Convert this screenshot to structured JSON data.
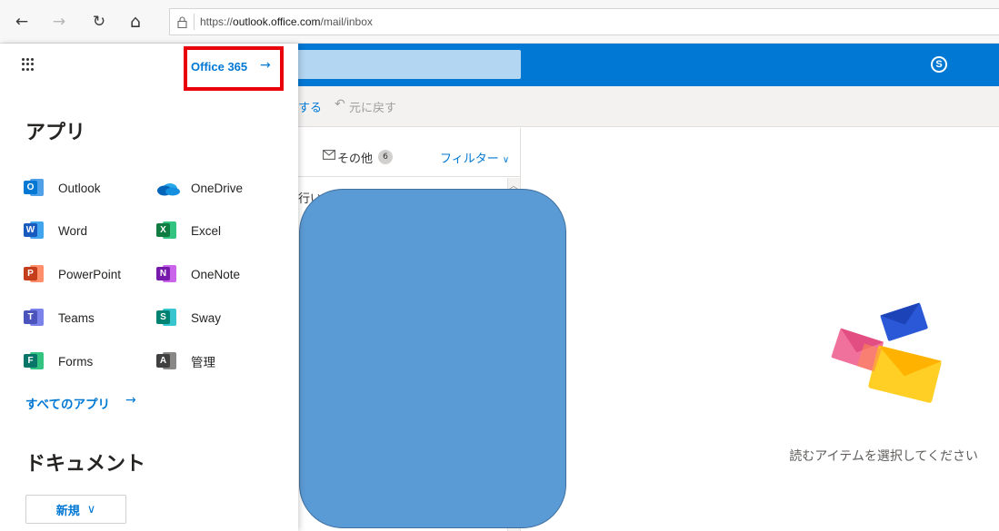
{
  "browser": {
    "back_icon": "←",
    "forward_icon": "→",
    "refresh_icon": "↻",
    "home_icon": "⌂",
    "url_prefix": "https://",
    "url_host": "outlook.office.com",
    "url_path": "/mail/inbox"
  },
  "header": {
    "skype_letter": "S"
  },
  "command_bar": {
    "action_label": "する",
    "undo_icon": "↶",
    "undo_label": "元に戻す"
  },
  "message_list": {
    "tab_other_label": "その他",
    "tab_other_count": "6",
    "filter_label": "フィルター",
    "filter_chevron": "∨",
    "peek_text": "行い"
  },
  "reading_pane": {
    "empty_text": "読むアイテムを選択してください"
  },
  "launcher": {
    "office365_label": "Office 365",
    "office365_arrow": "→",
    "apps_title": "アプリ",
    "apps": [
      {
        "label": "Outlook",
        "icon": "outlook-icon",
        "letter": "O",
        "color": "#0078d4",
        "back": "#50a0e8"
      },
      {
        "label": "OneDrive",
        "icon": "onedrive-icon",
        "letter": "",
        "color": "#0364b8",
        "back": "#28a8ea"
      },
      {
        "label": "Word",
        "icon": "word-icon",
        "letter": "W",
        "color": "#185abd",
        "back": "#41a5ee"
      },
      {
        "label": "Excel",
        "icon": "excel-icon",
        "letter": "X",
        "color": "#107c41",
        "back": "#33c481"
      },
      {
        "label": "PowerPoint",
        "icon": "powerpoint-icon",
        "letter": "P",
        "color": "#c43e1c",
        "back": "#ff8f6b"
      },
      {
        "label": "OneNote",
        "icon": "onenote-icon",
        "letter": "N",
        "color": "#7719aa",
        "back": "#ca64ea"
      },
      {
        "label": "Teams",
        "icon": "teams-icon",
        "letter": "T",
        "color": "#4b53bc",
        "back": "#7b83eb"
      },
      {
        "label": "Sway",
        "icon": "sway-icon",
        "letter": "S",
        "color": "#008272",
        "back": "#37c6d0"
      },
      {
        "label": "Forms",
        "icon": "forms-icon",
        "letter": "F",
        "color": "#077568",
        "back": "#33c481"
      },
      {
        "label": "管理",
        "icon": "admin-icon",
        "letter": "A",
        "color": "#404040",
        "back": "#8a8886"
      }
    ],
    "all_apps_label": "すべてのアプリ",
    "all_apps_arrow": "→",
    "documents_title": "ドキュメント",
    "new_label": "新規",
    "new_chevron": "∨"
  }
}
